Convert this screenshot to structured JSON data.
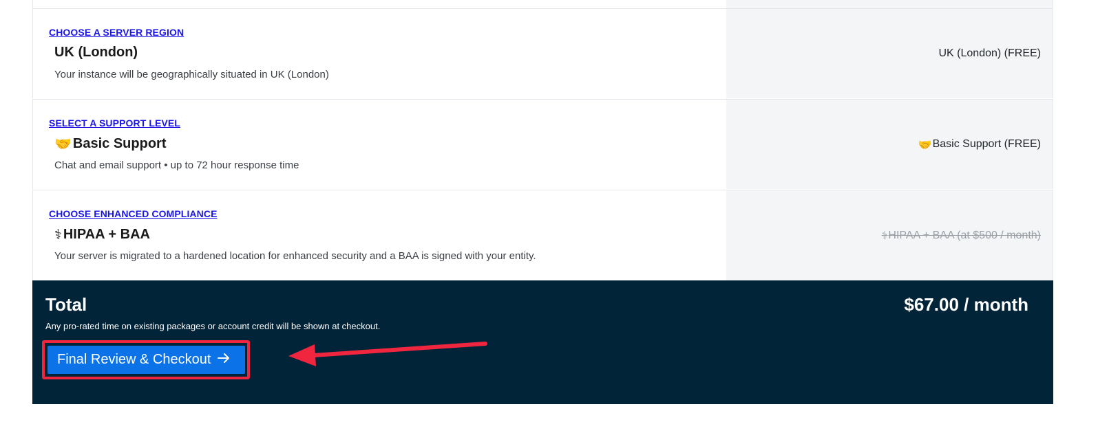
{
  "rows": [
    {
      "section_link": "CHOOSE A SERVER REGION",
      "title_icon": "",
      "title": "UK (London)",
      "description": "Your instance will be geographically situated in UK (London)",
      "summary_icon": "",
      "summary": "UK (London) (FREE)",
      "summary_struck": false
    },
    {
      "section_link": "SELECT A SUPPORT LEVEL",
      "title_icon": "🤝",
      "title": "Basic Support",
      "description": "Chat and email support • up to 72 hour response time",
      "summary_icon": "🤝",
      "summary": "Basic Support (FREE)",
      "summary_struck": false
    },
    {
      "section_link": "CHOOSE ENHANCED COMPLIANCE",
      "title_icon": "⚕",
      "title": "HIPAA + BAA",
      "description": "Your server is migrated to a hardened location for enhanced security and a BAA is signed with your entity.",
      "summary_icon": "⚕",
      "summary": "HIPAA + BAA (at $500 / month)",
      "summary_struck": true
    }
  ],
  "total": {
    "label": "Total",
    "note": "Any pro-rated time on existing packages or account credit will be shown at checkout.",
    "price": "$67.00 / month"
  },
  "checkout": {
    "label": "Final Review & Checkout",
    "icon": "arrow-right-icon"
  },
  "colors": {
    "link": "#1a14e8",
    "panel_bg": "#022438",
    "button_bg": "#0b72e7",
    "annotation": "#f0263f",
    "summary_bg": "#f4f5f7"
  }
}
